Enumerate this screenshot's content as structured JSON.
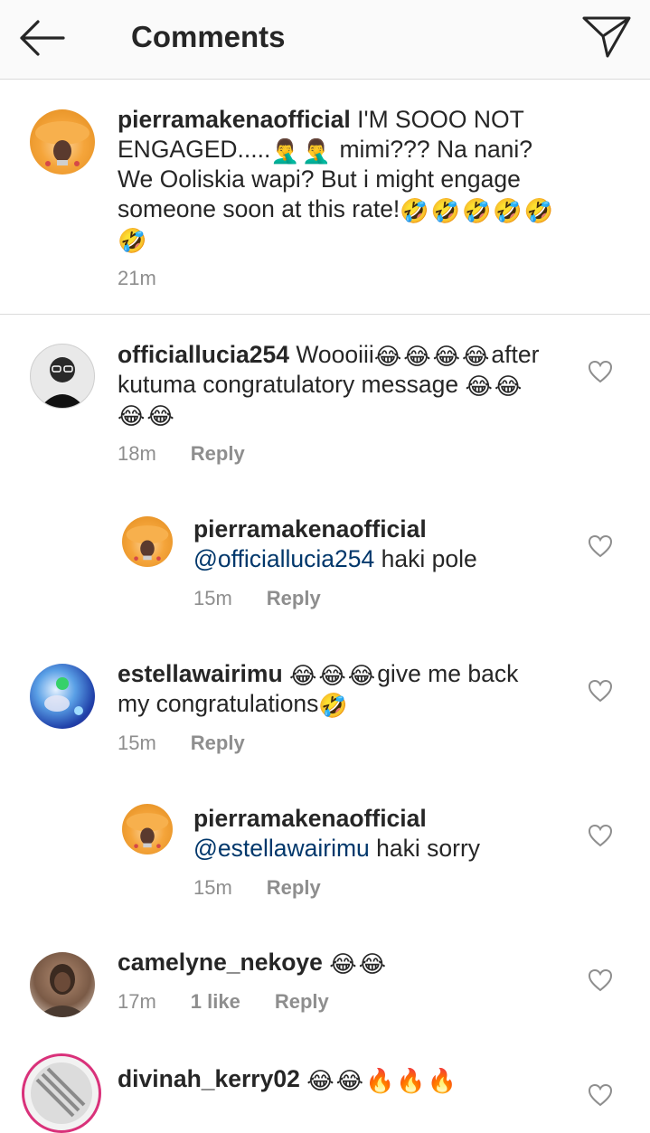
{
  "header": {
    "title": "Comments"
  },
  "caption": {
    "username": "pierramakenaofficial",
    "line1": "I'M SOOO NOT",
    "line2a": "ENGAGED.....",
    "line2b": "mimi??? Na nani?",
    "line3": "We Ooliskia wapi?  But i might engage",
    "line4": "someone soon at this rate!",
    "time": "21m"
  },
  "comments": [
    {
      "username": "officiallucia254",
      "line1": "Woooiii",
      "line1b": "after",
      "line2": "kutuma congratulatory message",
      "time": "18m",
      "reply_label": "Reply"
    },
    {
      "username": "pierramakenaofficial",
      "mention": "@officiallucia254",
      "text": "haki pole",
      "time": "15m",
      "reply_label": "Reply"
    },
    {
      "username": "estellawairimu",
      "line1": "give me back",
      "line2": "my congratulations",
      "time": "15m",
      "reply_label": "Reply"
    },
    {
      "username": "pierramakenaofficial",
      "mention": "@estellawairimu",
      "text": "haki sorry",
      "time": "15m",
      "reply_label": "Reply"
    },
    {
      "username": "camelyne_nekoye",
      "time": "17m",
      "likes": "1 like",
      "reply_label": "Reply"
    },
    {
      "username": "divinah_kerry02"
    }
  ],
  "emojis": {
    "rofl": "🤣",
    "facepalm": "🤦‍♂️",
    "joy": "😂",
    "fire": "🔥"
  },
  "colors": {
    "mention": "#00376b",
    "meta": "#8e8e8e",
    "divider": "#dbdbdb",
    "story_ring": "#d9317a"
  }
}
